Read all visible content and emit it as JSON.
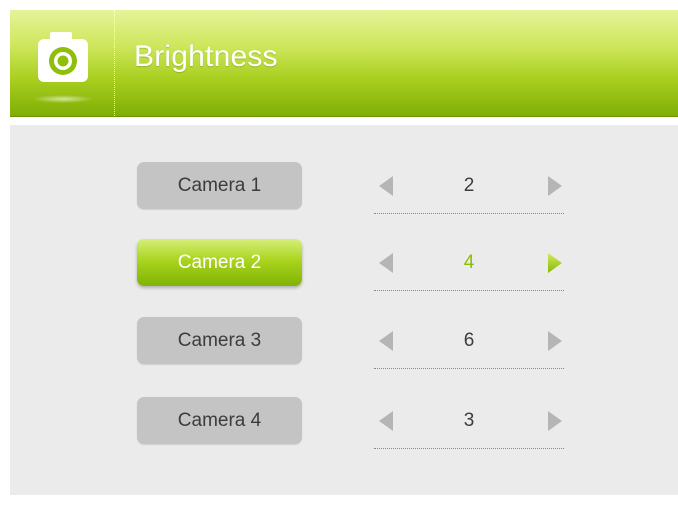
{
  "header": {
    "title": "Brightness",
    "icon": "camera-icon"
  },
  "colors": {
    "accent": "#9cc70c",
    "panel_bg": "#ebebeb",
    "button_inactive": "#c4c4c4",
    "active_value": "#8cbc00"
  },
  "cameras": [
    {
      "label": "Camera 1",
      "value": "2",
      "selected": false
    },
    {
      "label": "Camera 2",
      "value": "4",
      "selected": true
    },
    {
      "label": "Camera 3",
      "value": "6",
      "selected": false
    },
    {
      "label": "Camera 4",
      "value": "3",
      "selected": false
    }
  ]
}
